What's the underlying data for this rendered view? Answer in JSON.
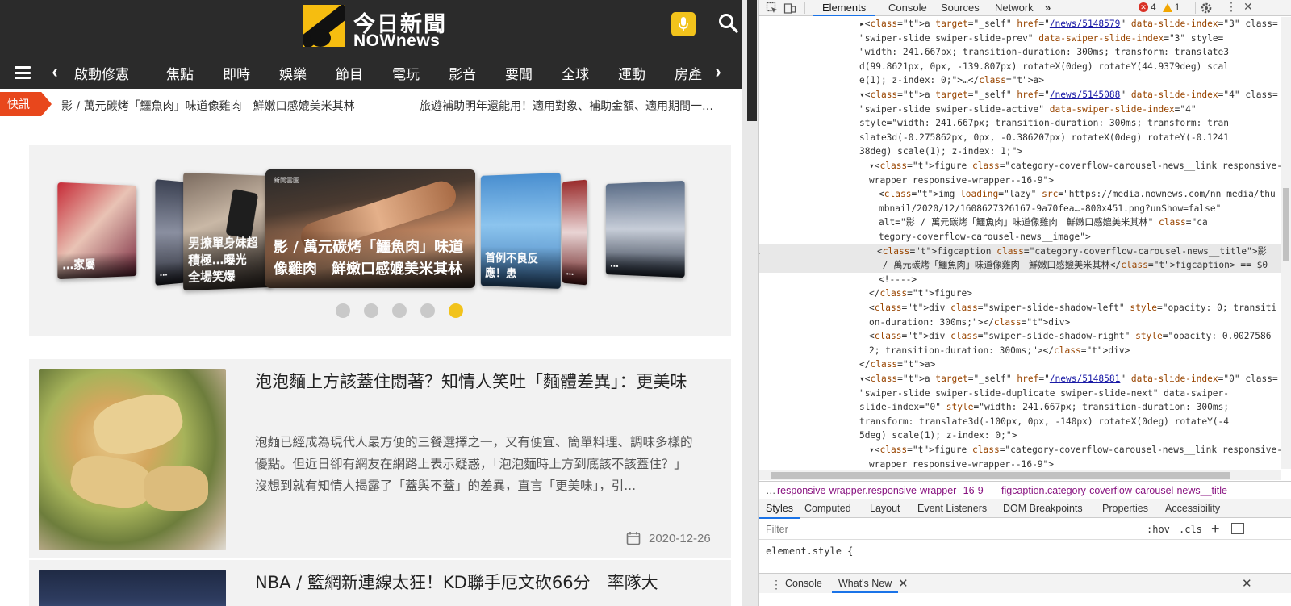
{
  "site": {
    "logo_zh": "今日新聞",
    "logo_en": "NOWnews",
    "nav": [
      "啟動修憲",
      "焦點",
      "即時",
      "娛樂",
      "節目",
      "電玩",
      "影音",
      "要聞",
      "全球",
      "運動",
      "房產"
    ],
    "ticker_label": "快訊",
    "ticker_items": [
      "影 / 萬元碳烤「鱷魚肉」味道像雞肉　鮮嫩口感媲美米其林",
      "旅遊補助明年還能用！適用對象、補助金額、適用期間一…"
    ],
    "carousel": {
      "slides": [
        {
          "caption": "…家屬"
        },
        {
          "caption": "…"
        },
        {
          "caption": "男撩單身妹超積極…曝光　全場笑爆"
        },
        {
          "caption": "影 / 萬元碳烤「鱷魚肉」味道像雞肉　鮮嫩口感媲美米其林",
          "tag": "新聞雲圖"
        },
        {
          "caption": "首例不良反應！患"
        },
        {
          "caption": "…"
        },
        {
          "caption": "…"
        }
      ],
      "dots": 5,
      "active_dot": 4
    },
    "articles": [
      {
        "title": "泡泡麵上方該蓋住悶著？知情人笑吐「麵體差異」：更美味",
        "summary": "泡麵已經成為現代人最方便的三餐選擇之一，又有便宜、簡單料理、調味多樣的優點。但近日卻有網友在網路上表示疑惑，「泡泡麵時上方到底該不該蓋住？」沒想到就有知情人揭露了「蓋與不蓋」的差異，直言「更美味」，引...",
        "date": "2020-12-26"
      },
      {
        "title": "NBA / 籃網新連線太狂！KD聯手厄文砍66分　率隊大"
      }
    ]
  },
  "devtools": {
    "tabs": [
      "Elements",
      "Console",
      "Sources",
      "Network"
    ],
    "active_tab": "Elements",
    "more": "»",
    "errors": "4",
    "warnings": "1",
    "dom_lines": [
      {
        "indent": 0,
        "html": "▸<a target=\"_self\" href=\"/news/5148579\" data-slide-index=\"3\" class="
      },
      {
        "indent": 0,
        "html": "\"swiper-slide swiper-slide-prev\" data-swiper-slide-index=\"3\" style="
      },
      {
        "indent": 0,
        "html": "\"width: 241.667px; transition-duration: 300ms; transform: translate3"
      },
      {
        "indent": 0,
        "html": "d(99.8621px, 0px, -139.807px) rotateX(0deg) rotateY(44.9379deg) scal"
      },
      {
        "indent": 0,
        "html": "e(1); z-index: 0;\">…</a>"
      },
      {
        "indent": 0,
        "html": "▾<a target=\"_self\" href=\"/news/5145088\" data-slide-index=\"4\" class="
      },
      {
        "indent": 0,
        "html": "\"swiper-slide swiper-slide-active\" data-swiper-slide-index=\"4\""
      },
      {
        "indent": 0,
        "html": "style=\"width: 241.667px; transition-duration: 300ms; transform: tran"
      },
      {
        "indent": 0,
        "html": "slate3d(-0.275862px, 0px, -0.386207px) rotateX(0deg) rotateY(-0.1241"
      },
      {
        "indent": 0,
        "html": "38deg) scale(1); z-index: 1;\">"
      },
      {
        "indent": 1,
        "html": "▾<figure class=\"category-coverflow-carousel-news__link responsive-"
      },
      {
        "indent": 1,
        "html": "wrapper responsive-wrapper--16-9\">"
      },
      {
        "indent": 2,
        "html": "<img loading=\"lazy\" src=\"https://media.nownews.com/nn_media/thu"
      },
      {
        "indent": 2,
        "html": "mbnail/2020/12/1608627326167-9a70fea…-800x451.png?unShow=false\""
      },
      {
        "indent": 2,
        "html": "alt=\"影 / 萬元碳烤「鱷魚肉」味道像雞肉　鮮嫩口感媲美米其林\" class=\"ca"
      },
      {
        "indent": 2,
        "html": "tegory-coverflow-carousel-news__image\">"
      },
      {
        "indent": 2,
        "html": "<figcaption class=\"category-coverflow-carousel-news__title\">影"
      },
      {
        "indent": 2,
        "html": " / 萬元碳烤「鱷魚肉」味道像雞肉　鮮嫩口感媲美米其林</figcaption> == $0"
      },
      {
        "indent": 2,
        "html": "<!---->"
      },
      {
        "indent": 1,
        "html": "</figure>"
      },
      {
        "indent": 1,
        "html": "<div class=\"swiper-slide-shadow-left\" style=\"opacity: 0; transiti"
      },
      {
        "indent": 1,
        "html": "on-duration: 300ms;\"></div>"
      },
      {
        "indent": 1,
        "html": "<div class=\"swiper-slide-shadow-right\" style=\"opacity: 0.0027586"
      },
      {
        "indent": 1,
        "html": "2; transition-duration: 300ms;\"></div>"
      },
      {
        "indent": 0,
        "html": "</a>"
      },
      {
        "indent": 0,
        "html": "▾<a target=\"_self\" href=\"/news/5148581\" data-slide-index=\"0\" class="
      },
      {
        "indent": 0,
        "html": "\"swiper-slide swiper-slide-duplicate swiper-slide-next\" data-swiper-"
      },
      {
        "indent": 0,
        "html": "slide-index=\"0\" style=\"width: 241.667px; transition-duration: 300ms;"
      },
      {
        "indent": 0,
        "html": "transform: translate3d(-100px, 0px, -140px) rotateX(0deg) rotateY(-4"
      },
      {
        "indent": 0,
        "html": "5deg) scale(1); z-index: 0;\">"
      },
      {
        "indent": 1,
        "html": "▾<figure class=\"category-coverflow-carousel-news__link responsive-"
      },
      {
        "indent": 1,
        "html": "wrapper responsive-wrapper--16-9\">"
      }
    ],
    "breadcrumbs": [
      "…",
      "responsive-wrapper.responsive-wrapper--16-9",
      "figcaption.category-coverflow-carousel-news__title"
    ],
    "styles_tabs": [
      "Styles",
      "Computed",
      "Layout",
      "Event Listeners",
      "DOM Breakpoints",
      "Properties",
      "Accessibility"
    ],
    "active_styles_tab": "Styles",
    "filter_placeholder": "Filter",
    "hov": ":hov",
    "cls": ".cls",
    "element_style": "element.style {",
    "drawer_tabs": [
      "Console",
      "What's New"
    ],
    "active_drawer_tab": "What's New"
  }
}
